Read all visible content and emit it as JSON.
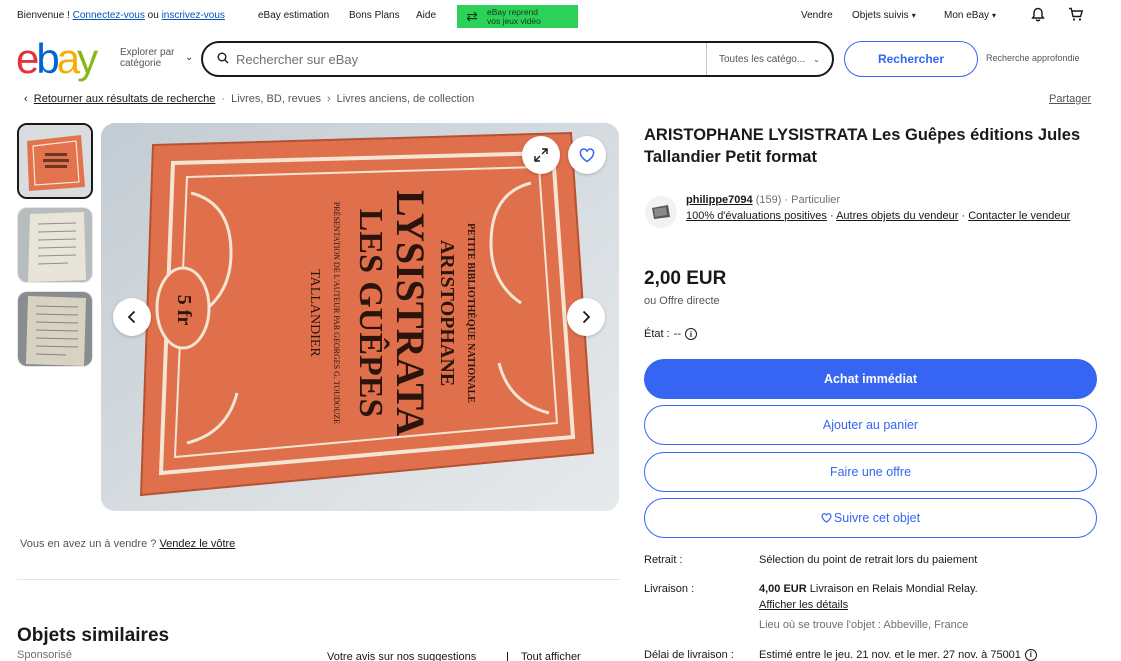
{
  "topbar": {
    "welcome": "Bienvenue !",
    "connect": "Connectez-vous",
    "or": "ou",
    "register": "inscrivez-vous",
    "nav": [
      "eBay estimation",
      "Bons Plans",
      "Aide"
    ],
    "promo_line1": "eBay reprend",
    "promo_line2": "vos jeux vidéo",
    "sell": "Vendre",
    "watchlist": "Objets suivis",
    "myebay": "Mon eBay"
  },
  "header": {
    "logo": {
      "e": "e",
      "b": "b",
      "a": "a",
      "y": "y"
    },
    "explore_line1": "Explorer par",
    "explore_line2": "catégorie",
    "search_placeholder": "Rechercher sur eBay",
    "category": "Toutes les catégo...",
    "search_button": "Rechercher",
    "advanced": "Recherche approfondie"
  },
  "breadcrumb": {
    "back": "Retourner aux résultats de recherche",
    "items": [
      "Livres, BD, revues",
      "Livres anciens, de collection"
    ],
    "share": "Partager"
  },
  "gallery": {
    "cover_text": {
      "collection": "PETITE BIBLIOTHÈQUE NATIONALE",
      "author": "ARISTOPHANE",
      "title1": "LYSISTRATA",
      "title2": "LES GUÊPES",
      "preface": "PRÉSENTATION DE L'AUTEUR PAR GEORGES G. TOUDOUZE",
      "publisher": "TALLANDIER",
      "price_stamp": "5 fr"
    }
  },
  "sell_prompt": {
    "text": "Vous en avez un à vendre ?",
    "link": "Vendez le vôtre"
  },
  "similar": {
    "title": "Objets similaires",
    "sponsored": "Sponsorisé",
    "feedback": "Votre avis sur nos suggestions",
    "see_all": "Tout afficher"
  },
  "listing": {
    "title": "ARISTOPHANE LYSISTRATA Les Guêpes éditions Jules Tallandier Petit format",
    "seller_name": "philippe7094",
    "seller_count": "(159)",
    "seller_type": "· Particulier",
    "positive": "100% d'évaluations positives",
    "other_items": "Autres objets du vendeur",
    "contact": "Contacter le vendeur",
    "price": "2,00 EUR",
    "offer": "ou Offre directe",
    "condition_label": "État :",
    "condition_value": "--",
    "buy_now": "Achat immédiat",
    "add_cart": "Ajouter au panier",
    "make_offer": "Faire une offre",
    "watch": "Suivre cet objet",
    "pickup_label": "Retrait :",
    "pickup_value": "Sélection du point de retrait lors du paiement",
    "shipping_label": "Livraison :",
    "shipping_price": "4,00 EUR",
    "shipping_desc": "Livraison en Relais Mondial Relay.",
    "shipping_details": "Afficher les détails",
    "location": "Lieu où se trouve l'objet : Abbeville, France",
    "delay_label": "Délai de livraison :",
    "delay_value": "Estimé entre le jeu. 21 nov. et le mer. 27 nov. à 75001"
  }
}
